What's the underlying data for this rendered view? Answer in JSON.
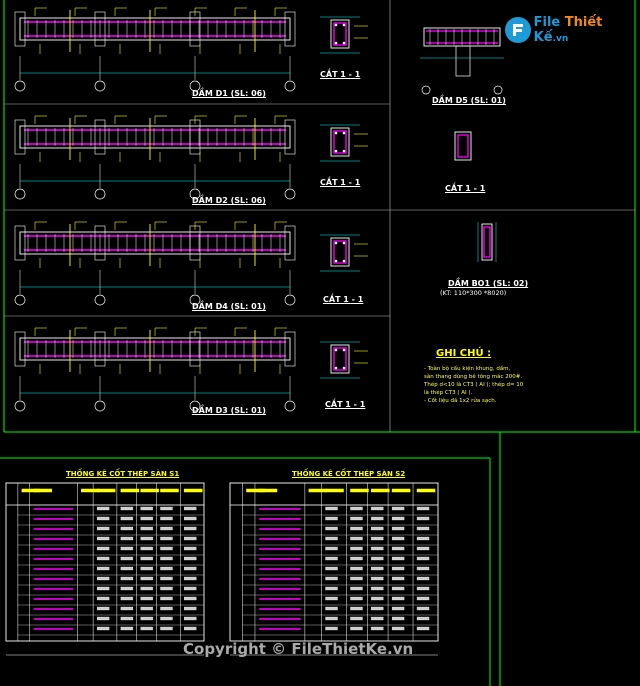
{
  "beams": [
    {
      "title": "DẦM D1 (SL: 06)",
      "section": "CẮT 1 - 1"
    },
    {
      "title": "DẦM D2 (SL: 06)",
      "section": "CẮT 1 - 1"
    },
    {
      "title": "DẦM D4 (SL: 01)",
      "section": "CẮT 1 - 1"
    },
    {
      "title": "DẦM D3 (SL: 01)",
      "section": "CẮT 1 - 1"
    }
  ],
  "side_details": {
    "d5_title": "DẦM D5 (SL: 01)",
    "d5_section": "CẮT 1 - 1",
    "bo1_title": "DẦM BO1 (SL: 02)",
    "bo1_sub": "(KT: 110*300 *8020)"
  },
  "notes": {
    "heading": "GHI CHÚ :",
    "lines": [
      "- Toàn bộ cấu kiện khung, dầm,",
      "sàn thang dùng bê tông mác 200#.",
      "Thép d<10 là CT3 ( AI ); thép d= 10",
      "là thép CT3 ( AI ).",
      "- Cốt liệu đá 1x2 rửa sạch."
    ]
  },
  "tables": {
    "left_title": "THỐNG KÊ CỐT THÉP SÀN S1",
    "right_title": "THỐNG KÊ CỐT THÉP SÀN S2"
  },
  "watermark": {
    "logo_file": "File",
    "logo_thiet": "Thiết",
    "logo_ke": "Kế",
    "logo_vn": ".vn",
    "copyright": "Copyright © FileThietKe.vn"
  },
  "colors": {
    "background": "#000000",
    "rebar": "#ff00ff",
    "line": "#ffffff",
    "dimension": "#00ffff",
    "label": "#ffff00",
    "frame": "#00ff00",
    "logo_blue": "#1e9ad6",
    "logo_orange": "#f08a1c"
  }
}
